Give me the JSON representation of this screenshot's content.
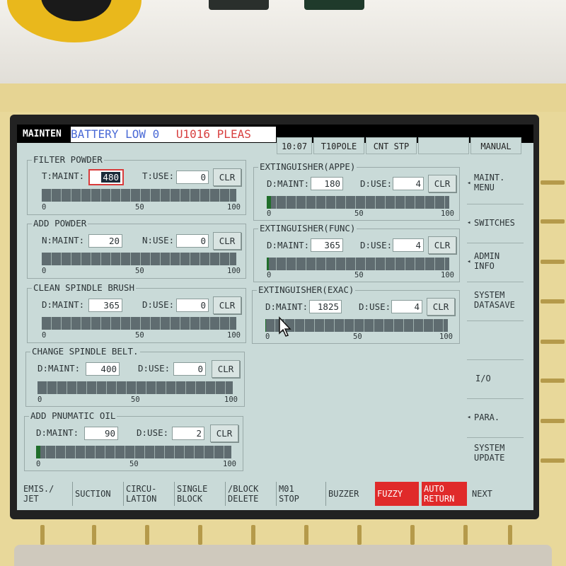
{
  "topbar": {
    "mode": "MAINTEN",
    "alarm_primary": "BATTERY LOW 0",
    "alarm_secondary": "U1016 PLEAS",
    "time": "10:07",
    "tool": "T10POLE",
    "cnt_status": "CNT STP",
    "blank": "",
    "op_mode": "MANUAL"
  },
  "colors": {
    "alarm_blue": "#4a6ad6",
    "alarm_red": "#d84040",
    "progress_green": "#1f6e2a",
    "highlight_red": "#d93b3b"
  },
  "gauge_ticks": [
    "0",
    "50",
    "100"
  ],
  "items": {
    "filter_powder": {
      "title": "FILTER POWDER",
      "maint_label": "T:MAINT:",
      "maint": "480",
      "use_label": "T:USE:",
      "use": "0",
      "progress": 0
    },
    "add_powder": {
      "title": "ADD POWDER",
      "maint_label": "N:MAINT:",
      "maint": "20",
      "use_label": "N:USE:",
      "use": "0",
      "progress": 0
    },
    "clean_spindle_brush": {
      "title": "CLEAN SPINDLE BRUSH",
      "maint_label": "D:MAINT:",
      "maint": "365",
      "use_label": "D:USE:",
      "use": "0",
      "progress": 0
    },
    "change_spindle_belt": {
      "title": "CHANGE SPINDLE BELT.",
      "maint_label": "D:MAINT:",
      "maint": "400",
      "use_label": "D:USE:",
      "use": "0",
      "progress": 0
    },
    "add_pnumatic_oil": {
      "title": "ADD PNUMATIC OIL",
      "maint_label": "D:MAINT:",
      "maint": "90",
      "use_label": "D:USE:",
      "use": "2",
      "progress": 2.2
    },
    "ext_appe": {
      "title": "EXTINGUISHER(APPE)",
      "maint_label": "D:MAINT:",
      "maint": "180",
      "use_label": "D:USE:",
      "use": "4",
      "progress": 2.2
    },
    "ext_func": {
      "title": "EXTINGUISHER(FUNC)",
      "maint_label": "D:MAINT:",
      "maint": "365",
      "use_label": "D:USE:",
      "use": "4",
      "progress": 1.1
    },
    "ext_exac": {
      "title": "EXTINGUISHER(EXAC)",
      "maint_label": "D:MAINT:",
      "maint": "1825",
      "use_label": "D:USE:",
      "use": "4",
      "progress": 0.2
    }
  },
  "clr_label": "CLR",
  "side_menu": {
    "maint_menu": "MAINT.\nMENU",
    "switches": "SWITCHES",
    "admin_info": "ADMIN\nINFO",
    "system_datasave": "SYSTEM\nDATASAVE",
    "io": "I/O",
    "para": "PARA.",
    "system_update": "SYSTEM\nUPDATE"
  },
  "function_keys": {
    "emis_jet": "EMIS./\nJET",
    "suction": "SUCTION",
    "circulation": "CIRCU-\nLATION",
    "single_block": "SINGLE\nBLOCK",
    "block_delete": "/BLOCK\nDELETE",
    "m01_stop": "M01\nSTOP",
    "buzzer": "BUZZER",
    "fuzzy": "FUZZY",
    "auto_return": "AUTO\nRETURN",
    "next": "NEXT"
  }
}
